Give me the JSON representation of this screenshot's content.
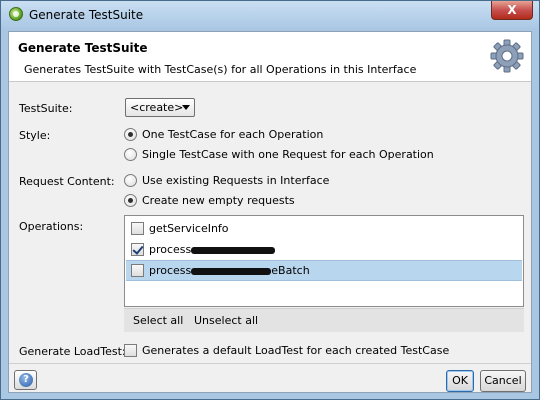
{
  "window": {
    "title": "Generate TestSuite",
    "close_label": "X"
  },
  "header": {
    "title": "Generate TestSuite",
    "description": "Generates TestSuite with TestCase(s) for all Operations in this Interface"
  },
  "form": {
    "testsuite_label": "TestSuite:",
    "testsuite_value": "<create>",
    "style_label": "Style:",
    "style_options": [
      {
        "label": "One TestCase for each Operation",
        "selected": true
      },
      {
        "label": "Single TestCase with one Request for each Operation",
        "selected": false
      }
    ],
    "request_content_label": "Request Content:",
    "request_options": [
      {
        "label": "Use existing Requests in Interface",
        "selected": false
      },
      {
        "label": "Create new empty requests",
        "selected": true
      }
    ],
    "operations_label": "Operations:",
    "operations": [
      {
        "prefix": "getServiceInfo",
        "suffix": "",
        "checked": false,
        "redacted": false,
        "highlighted": false
      },
      {
        "prefix": "process",
        "suffix": "",
        "checked": true,
        "redacted": true,
        "highlighted": false
      },
      {
        "prefix": "process",
        "suffix": "eBatch",
        "checked": false,
        "redacted": true,
        "highlighted": true
      }
    ],
    "select_all_label": "Select all",
    "unselect_all_label": "Unselect all",
    "loadtest_label": "Generate LoadTest:",
    "loadtest_text": "Generates a default LoadTest for each created TestCase"
  },
  "footer": {
    "help_glyph": "?",
    "ok_label": "OK",
    "cancel_label": "Cancel"
  },
  "colors": {
    "selection": "#b9d6ef",
    "window_frame": "#a9c6e3"
  }
}
